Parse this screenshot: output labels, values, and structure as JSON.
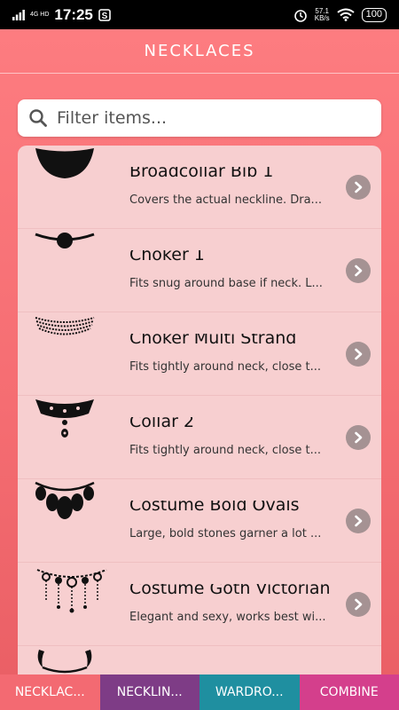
{
  "status_bar": {
    "network": "4G HD",
    "time": "17:25",
    "speed_value": "57.1",
    "speed_unit": "KB/s",
    "battery": "100"
  },
  "header": {
    "title": "NECKLACES"
  },
  "search": {
    "placeholder": "Filter items...",
    "icon": "search-icon"
  },
  "items": [
    {
      "title": "Broadcollar Bib 1",
      "desc": "Covers the actual neckline. Dra...",
      "icon": "bib-necklace-icon"
    },
    {
      "title": "Choker 1",
      "desc": "Fits snug around base if neck. L...",
      "icon": "choker-icon"
    },
    {
      "title": "Choker Multi Strand",
      "desc": "Fits tightly around neck, close t...",
      "icon": "multi-strand-choker-icon"
    },
    {
      "title": "Collar 2",
      "desc": "Fits tightly around neck, close t...",
      "icon": "collar-necklace-icon"
    },
    {
      "title": "Costume Bold Ovals",
      "desc": "Large, bold stones garner a lot ...",
      "icon": "bold-ovals-necklace-icon"
    },
    {
      "title": "Costume Goth Victorian",
      "desc": "Elegant and sexy, works best wi...",
      "icon": "goth-victorian-necklace-icon"
    },
    {
      "title": "",
      "desc": "",
      "icon": "horn-necklace-icon"
    }
  ],
  "tabs": [
    {
      "label": "NECKLAC...",
      "color": "#f36a72"
    },
    {
      "label": "NECKLIN...",
      "color": "#7e3c86"
    },
    {
      "label": "WARDRO...",
      "color": "#1f8fa0"
    },
    {
      "label": "COMBINE",
      "color": "#d43f8c"
    }
  ],
  "colors": {
    "accent": "#f56d72",
    "list_background": "#f7cfd0",
    "chevron": "#a59293"
  }
}
